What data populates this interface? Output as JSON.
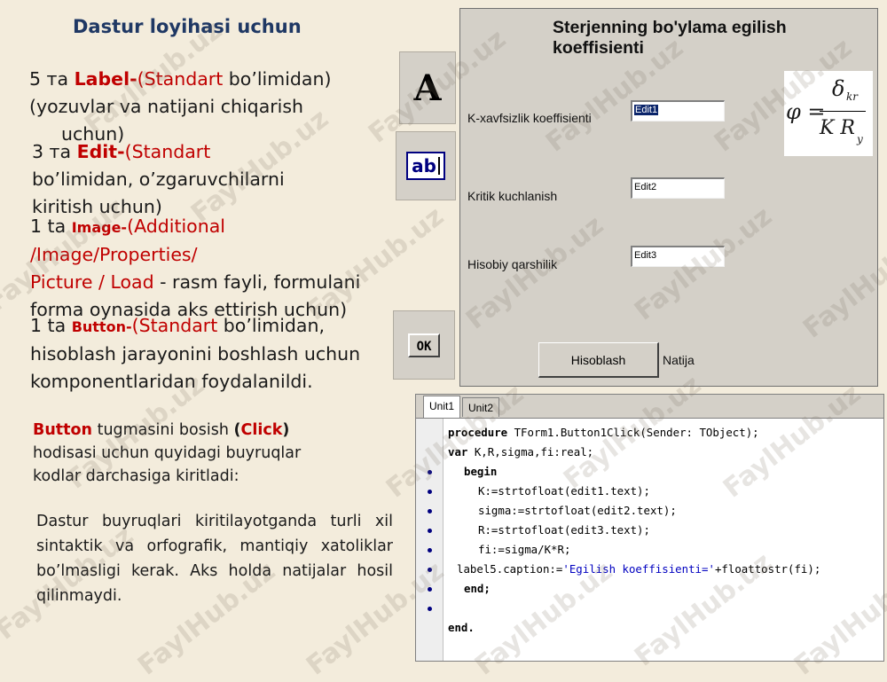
{
  "slide": {
    "title": "Dastur loyihasi uchun",
    "watermark_text": "FaylHub.uz",
    "para_label": {
      "count": "5 та ",
      "name": "Label-",
      "open": "(",
      "standart": "Standart",
      "rest1": " bo’limidan)",
      "line2": "(yozuvlar va natijani chiqarish",
      "line3": "uchun)"
    },
    "para_edit": {
      "count": "3 та ",
      "name": "Edit-",
      "open": "(",
      "standart": "Standart",
      "line2": "bo’limidan, o’zgaruvchilarni",
      "line3": "kiritish uchun)"
    },
    "para_image": {
      "count": "1 ta ",
      "name": "Image-",
      "open": "(",
      "additional": "Additional",
      "line2": "/Image/Properties/",
      "picture_load": "Picture / Load",
      "rest3": " - rasm fayli, formulani",
      "line4": "forma oynasida aks ettirish uchun)"
    },
    "para_button": {
      "count": "1 ta ",
      "name": "Button-",
      "open": "(",
      "standart": "Standart",
      "rest1": " bo’limidan,",
      "line2": "hisoblash jarayonini boshlash uchun",
      "line3": "komponentlaridan foydalanildi."
    },
    "para_click": {
      "button_word": "Button",
      "rest1": " tugmasini bosish ",
      "open": "(",
      "click_word": "Click",
      "close": ")",
      "line2": "hodisasi uchun quyidagi buyruqlar",
      "line3": "kodlar darchasiga kiritladi:"
    },
    "para_note": "Dastur buyruqlari kiritilayotganda turli xil sintaktik va orfografik, mantiqiy xatoliklar bo’lmasligi kerak. Aks holda natijalar hosil qilinmaydi."
  },
  "palette_icons": {
    "label_icon_glyph": "A",
    "edit_icon_glyph": "ab",
    "button_icon_glyph": "OK"
  },
  "form": {
    "title": "Sterjenning bo'ylama egilish koeffisienti",
    "labels": [
      "K-xavfsizlik koeffisienti",
      "Kritik kuchlanish",
      "Hisobiy qarshilik"
    ],
    "edits": [
      "Edit1",
      "Edit2",
      "Edit3"
    ],
    "button": "Hisoblash",
    "result_label": "Natija",
    "formula": {
      "lhs": "φ =",
      "num": "δ",
      "num_sub": "kr",
      "den": "K R",
      "den_sub": "y"
    }
  },
  "editor": {
    "tabs": [
      "Unit1",
      "Unit2"
    ],
    "active_tab": "Unit1",
    "code": {
      "l1_kw": "procedure",
      "l1_rest": " TForm1.Button1Click(Sender: TObject);",
      "l2_kw": "var",
      "l2_rest": " K,R,sigma,fi:real;",
      "l3_kw": "begin",
      "l4": "K:=strtofloat(edit1.text);",
      "l5": "sigma:=strtofloat(edit2.text);",
      "l6": "R:=strtofloat(edit3.text);",
      "l7": "fi:=sigma/K*R;",
      "l8_a": "label5.caption:=",
      "l8_str": "'Egilish koeffisienti='",
      "l8_b": "+floattostr(fi);",
      "l9_kw": "end",
      "l9_rest": ";",
      "l10_kw": "end",
      "l10_rest": "."
    }
  },
  "colors": {
    "background": "#f3ecdc",
    "title": "#1f3864",
    "accent_red": "#c00000",
    "form_face": "#d4d0c8",
    "code_string": "#0000c0"
  }
}
